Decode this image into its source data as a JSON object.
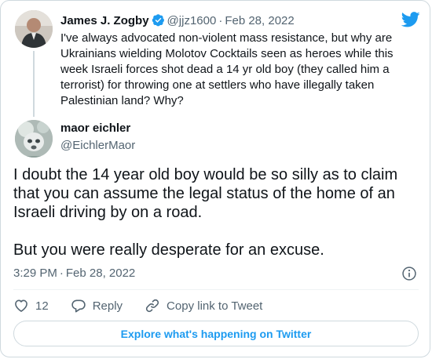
{
  "parent_tweet": {
    "author_name": "James J. Zogby",
    "handle": "@jjz1600",
    "separator": "·",
    "date": "Feb 28, 2022",
    "text": "I've always advocated non-violent mass resistance, but why are Ukrainians wielding Molotov Cocktails seen as heroes while this week Israeli forces shot dead a 14 yr old boy (they called him a terrorist) for throwing one at settlers who have illegally taken Palestinian land? Why?"
  },
  "tweet": {
    "author_name": "maor eichler",
    "handle": "@EichlerMaor",
    "text_paragraphs": [
      "I doubt the 14 year old boy would be so silly as to claim that you can assume the legal status of the home of an Israeli driving by on a road.",
      "But you were really desperate for an excuse."
    ],
    "time": "3:29 PM",
    "separator": "·",
    "date": "Feb 28, 2022"
  },
  "actions": {
    "like_count": "12",
    "reply_label": "Reply",
    "copy_link_label": "Copy link to Tweet"
  },
  "footer": {
    "explore_label": "Explore what's happening on Twitter"
  },
  "colors": {
    "accent": "#1d9bf0",
    "muted_text": "#536471",
    "border": "#cfd9de"
  },
  "icons": [
    "twitter-bird-icon",
    "verified-badge-icon",
    "info-icon",
    "heart-icon",
    "reply-icon",
    "link-icon"
  ]
}
